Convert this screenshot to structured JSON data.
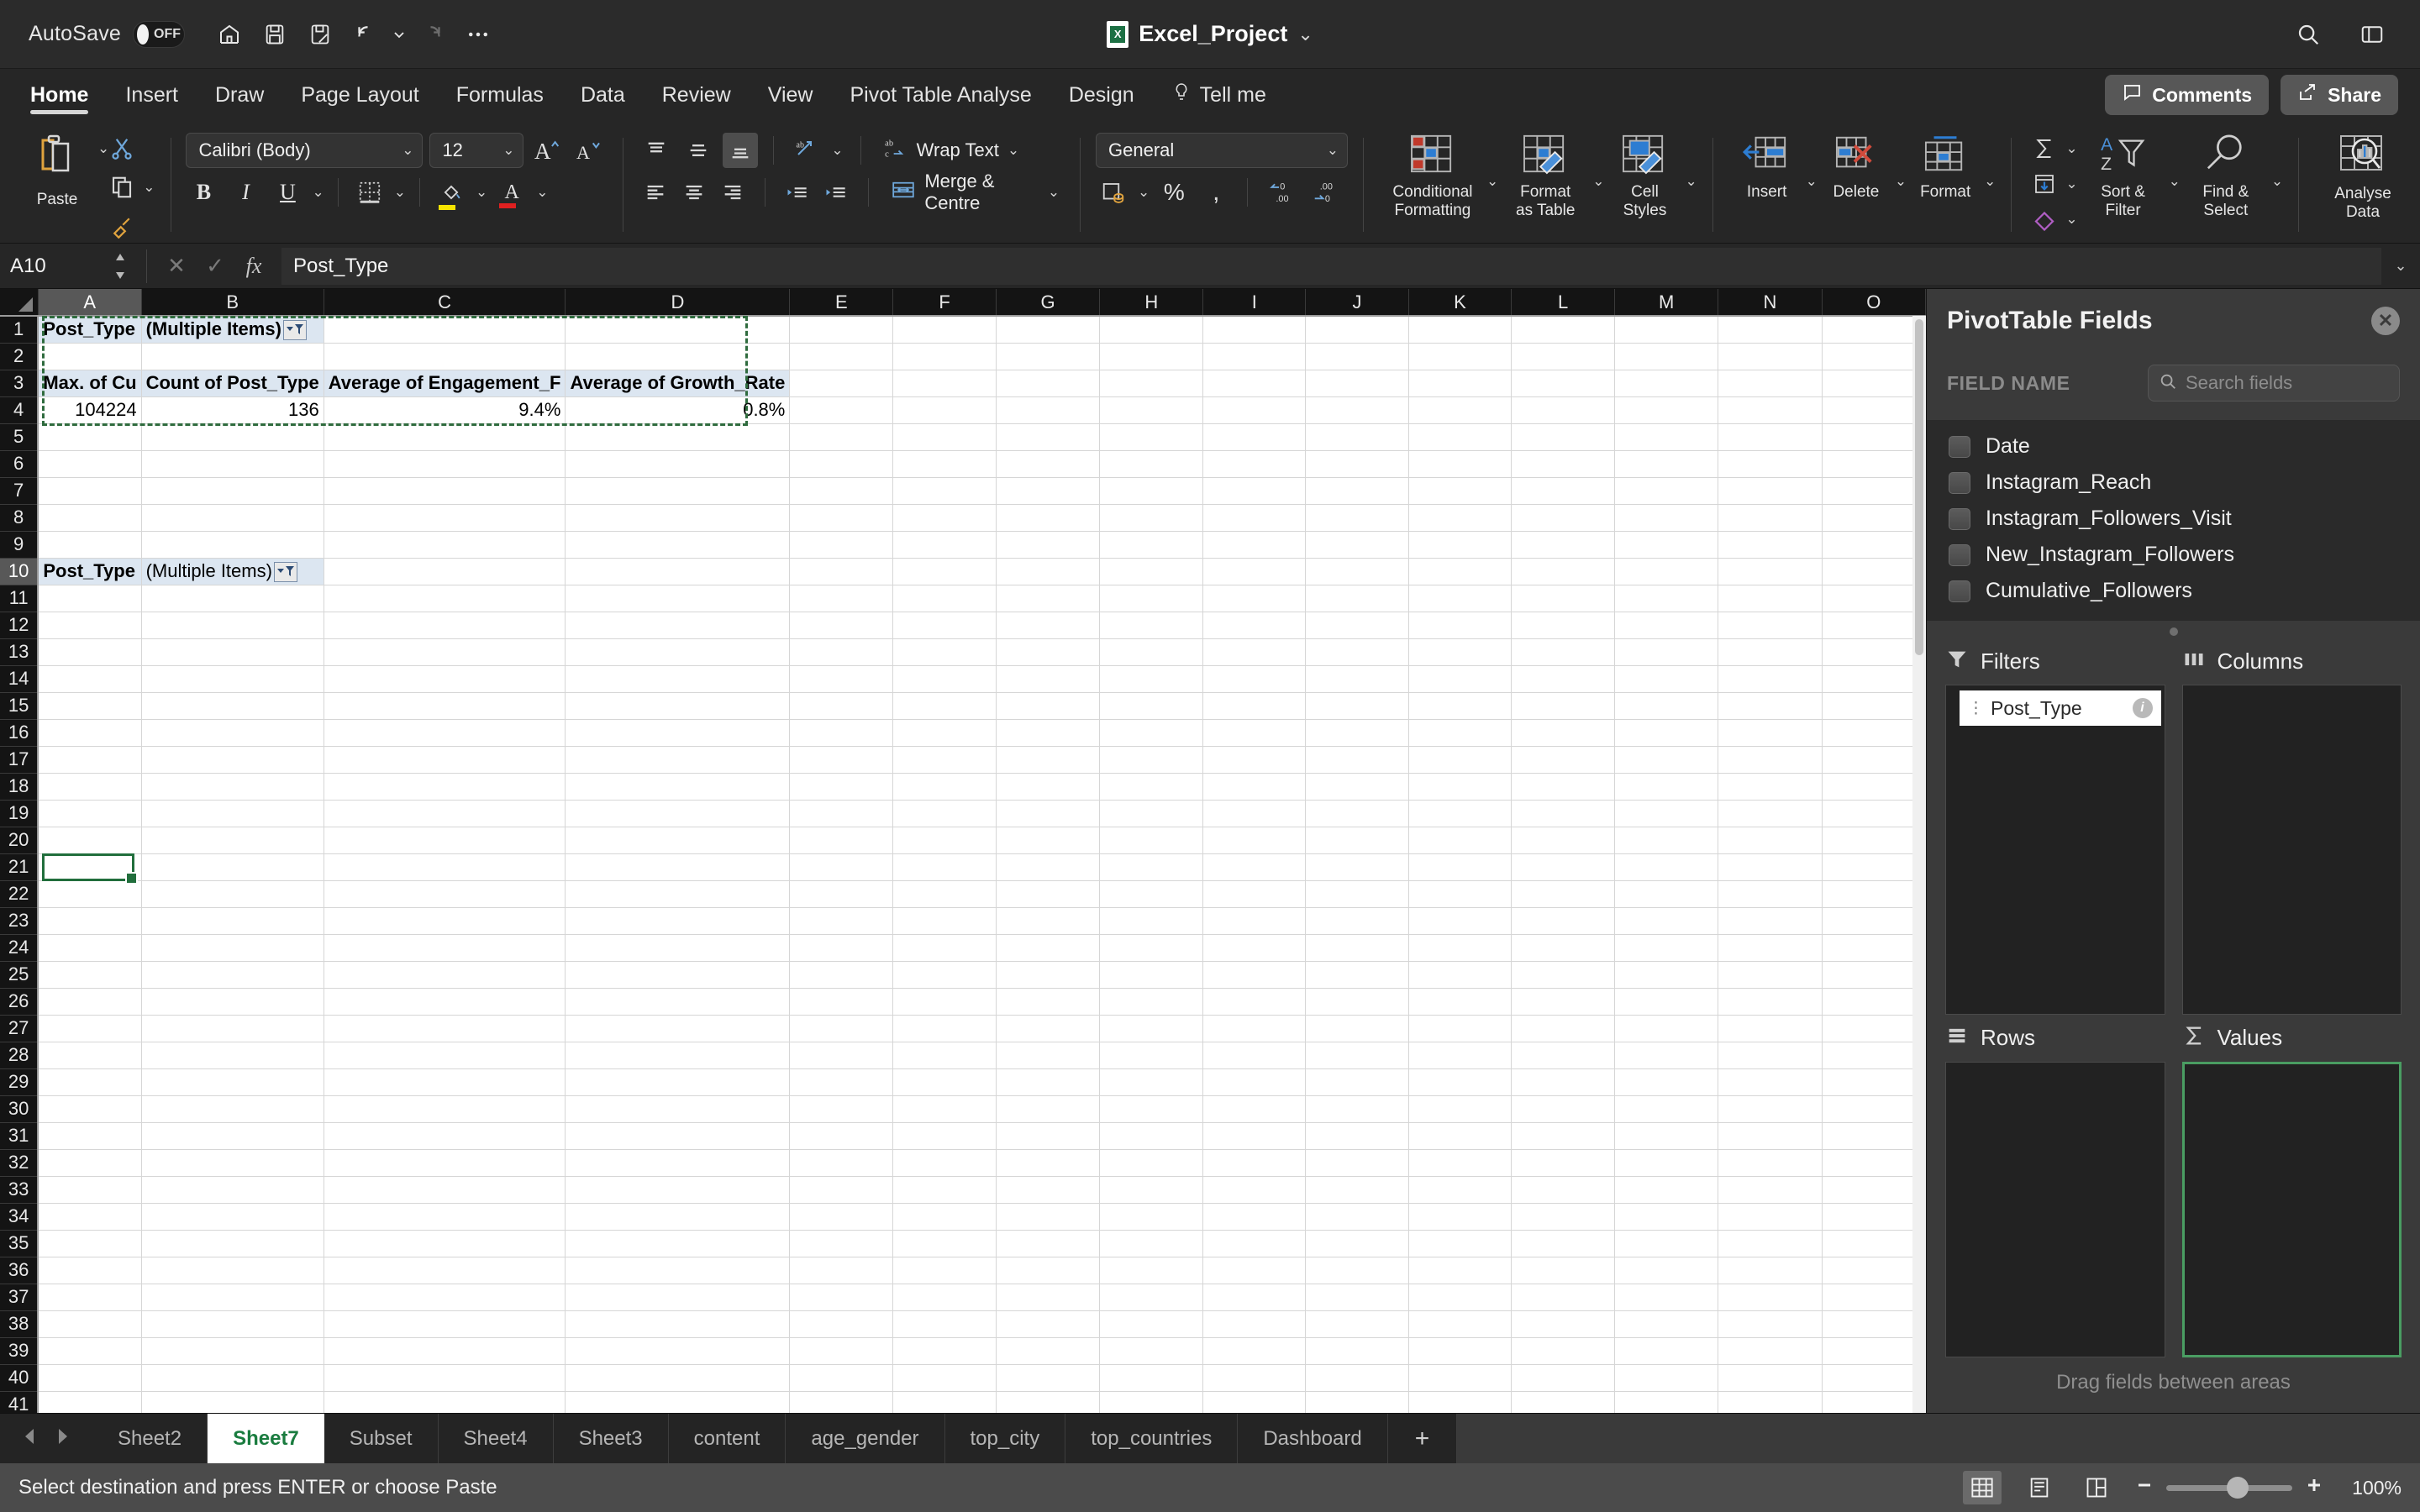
{
  "titlebar": {
    "autosave_label": "AutoSave",
    "autosave_state": "OFF",
    "document_title": "Excel_Project",
    "icons": [
      "home-icon",
      "save-icon",
      "save-as-icon",
      "undo-icon",
      "redo-icon",
      "more-icon"
    ],
    "right_icons": [
      "search-icon",
      "ribbon-display-icon"
    ]
  },
  "ribbon_tabs": {
    "items": [
      {
        "label": "Home",
        "active": true
      },
      {
        "label": "Insert",
        "active": false
      },
      {
        "label": "Draw",
        "active": false
      },
      {
        "label": "Page Layout",
        "active": false
      },
      {
        "label": "Formulas",
        "active": false
      },
      {
        "label": "Data",
        "active": false
      },
      {
        "label": "Review",
        "active": false
      },
      {
        "label": "View",
        "active": false
      },
      {
        "label": "Pivot Table Analyse",
        "active": false
      },
      {
        "label": "Design",
        "active": false
      }
    ],
    "tell_me": "Tell me",
    "comments": "Comments",
    "share": "Share"
  },
  "ribbon": {
    "paste_label": "Paste",
    "font_name": "Calibri (Body)",
    "font_size": "12",
    "wrap_text": "Wrap Text",
    "merge_centre": "Merge & Centre",
    "number_format": "General",
    "conditional_formatting": "Conditional\nFormatting",
    "conditional_formatting_l1": "Conditional",
    "conditional_formatting_l2": "Formatting",
    "format_as_table_l1": "Format",
    "format_as_table_l2": "as Table",
    "cell_styles_l1": "Cell",
    "cell_styles_l2": "Styles",
    "insert_label": "Insert",
    "delete_label": "Delete",
    "format_label": "Format",
    "sort_filter_l1": "Sort &",
    "sort_filter_l2": "Filter",
    "find_select_l1": "Find &",
    "find_select_l2": "Select",
    "analyse_data_l1": "Analyse",
    "analyse_data_l2": "Data"
  },
  "formula_bar": {
    "name_box": "A10",
    "formula_value": "Post_Type"
  },
  "grid": {
    "columns": [
      "A",
      "B",
      "C",
      "D",
      "E",
      "F",
      "G",
      "H",
      "I",
      "J",
      "K",
      "L",
      "M",
      "N",
      "O"
    ],
    "selected_column": "A",
    "selected_row": 10,
    "rows": [
      1,
      2,
      3,
      4,
      5,
      6,
      7,
      8,
      9,
      10,
      11,
      12,
      13,
      14,
      15,
      16,
      17,
      18,
      19,
      20,
      21,
      22,
      23,
      24,
      25,
      26,
      27,
      28,
      29,
      30,
      31,
      32,
      33,
      34,
      35,
      36,
      37,
      38,
      39,
      40,
      41
    ],
    "cells": {
      "A1": "Post_Type",
      "B1": "(Multiple Items)",
      "A3": "Max. of Cu",
      "B3": "Count of Post_Type",
      "C3": "Average of Engagement_F",
      "D3": "Average of Growth_Rate",
      "A4": "104224",
      "B4": "136",
      "C4": "9.4%",
      "D4": "0.8%",
      "A10": "Post_Type",
      "B10": "(Multiple Items)"
    }
  },
  "pivot_panel": {
    "title": "PivotTable Fields",
    "field_name_header": "FIELD NAME",
    "search_placeholder": "Search fields",
    "fields": [
      {
        "label": "Date",
        "checked": false
      },
      {
        "label": "Instagram_Reach",
        "checked": false
      },
      {
        "label": "Instagram_Followers_Visit",
        "checked": false
      },
      {
        "label": "New_Instagram_Followers",
        "checked": false
      },
      {
        "label": "Cumulative_Followers",
        "checked": false
      }
    ],
    "areas": [
      {
        "name": "Filters",
        "icon": "filter-icon",
        "chips": [
          "Post_Type"
        ],
        "highlight": false
      },
      {
        "name": "Columns",
        "icon": "columns-icon",
        "chips": [],
        "highlight": false
      },
      {
        "name": "Rows",
        "icon": "rows-icon",
        "chips": [],
        "highlight": false
      },
      {
        "name": "Values",
        "icon": "sigma-icon",
        "chips": [],
        "highlight": true
      }
    ],
    "drag_hint": "Drag fields between areas"
  },
  "sheet_tabs": {
    "items": [
      {
        "label": "Sheet2",
        "active": false
      },
      {
        "label": "Sheet7",
        "active": true
      },
      {
        "label": "Subset",
        "active": false
      },
      {
        "label": "Sheet4",
        "active": false
      },
      {
        "label": "Sheet3",
        "active": false
      },
      {
        "label": "content",
        "active": false
      },
      {
        "label": "age_gender",
        "active": false
      },
      {
        "label": "top_city",
        "active": false
      },
      {
        "label": "top_countries",
        "active": false
      },
      {
        "label": "Dashboard",
        "active": false
      }
    ],
    "add_label": "+"
  },
  "status_bar": {
    "message": "Select destination and press ENTER or choose Paste",
    "zoom": "100%",
    "views": [
      "normal-view-icon",
      "page-layout-icon",
      "page-break-icon"
    ]
  },
  "colors": {
    "accent_green": "#1a7c3f",
    "pivot_header_fill": "#dce6f1",
    "selection_green": "#216e3c",
    "ribbon_bg": "#262626"
  }
}
